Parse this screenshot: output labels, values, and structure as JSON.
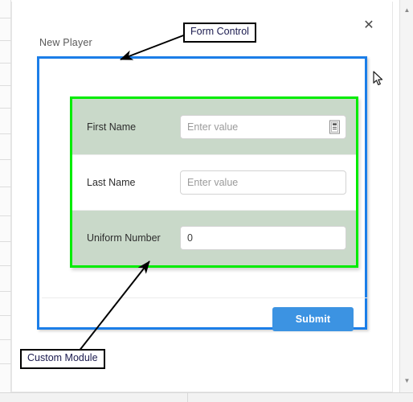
{
  "window": {
    "close_label": "✕",
    "scroll_up": "▲",
    "scroll_down": "▼"
  },
  "modal": {
    "title": "New Player",
    "submit_label": "Submit"
  },
  "fields": [
    {
      "label": "First Name",
      "value": "",
      "placeholder": "Enter value",
      "shaded": true,
      "addon_icon": "contact-card-icon"
    },
    {
      "label": "Last Name",
      "value": "",
      "placeholder": "Enter value",
      "shaded": false,
      "addon_icon": ""
    },
    {
      "label": "Uniform Number",
      "value": "0",
      "placeholder": "",
      "shaded": true,
      "addon_icon": ""
    }
  ],
  "annotations": {
    "form_control": "Form Control",
    "custom_module": "Custom Module"
  },
  "colors": {
    "form_control_outline": "#1b7ee8",
    "custom_module_outline": "#00ec00",
    "row_shade": "#c9d9c9",
    "submit_bg": "#3c93e2",
    "annotation_text": "#1b1b4f"
  }
}
